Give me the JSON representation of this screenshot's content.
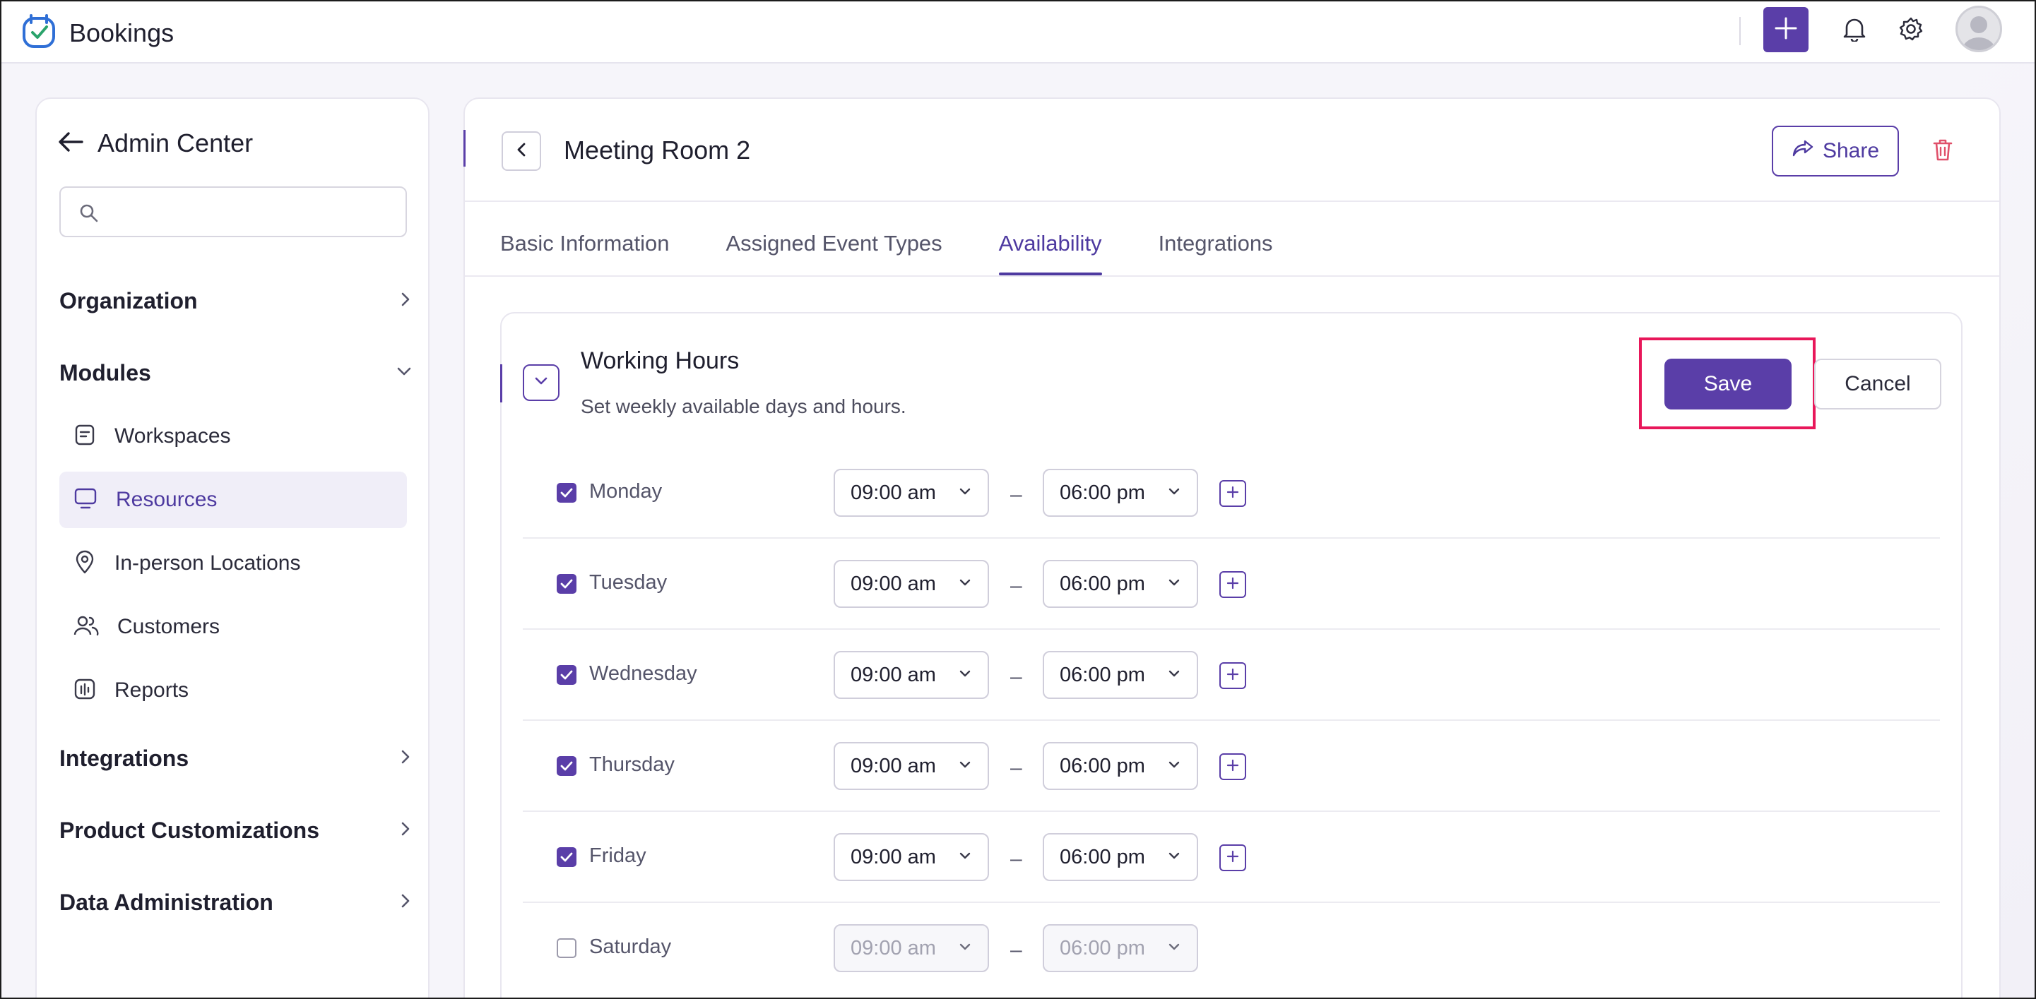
{
  "app": {
    "title": "Bookings",
    "brand_color": "#5a3ea8"
  },
  "topbar": {
    "icons": [
      "plus-icon",
      "bell-icon",
      "gear-icon",
      "avatar"
    ]
  },
  "sidebar": {
    "title": "Admin Center",
    "search": {
      "placeholder": "",
      "value": ""
    },
    "sections": {
      "organization": "Organization",
      "modules": "Modules",
      "integrations": "Integrations",
      "product_customizations": "Product Customizations",
      "data_administration": "Data Administration"
    },
    "module_items": [
      {
        "label": "Workspaces",
        "icon": "workspace-icon"
      },
      {
        "label": "Resources",
        "icon": "monitor-icon",
        "active": true
      },
      {
        "label": "In-person Locations",
        "icon": "location-pin-icon"
      },
      {
        "label": "Customers",
        "icon": "users-icon"
      },
      {
        "label": "Reports",
        "icon": "reports-icon"
      }
    ]
  },
  "main": {
    "title": "Meeting Room 2",
    "share_label": "Share",
    "tabs": [
      {
        "label": "Basic Information"
      },
      {
        "label": "Assigned Event Types"
      },
      {
        "label": "Availability",
        "active": true
      },
      {
        "label": "Integrations"
      }
    ],
    "working_hours": {
      "title": "Working Hours",
      "subtitle": "Set weekly available days and hours.",
      "save_label": "Save",
      "cancel_label": "Cancel",
      "days": [
        {
          "day": "Monday",
          "checked": true,
          "start": "09:00 am",
          "end": "06:00 pm"
        },
        {
          "day": "Tuesday",
          "checked": true,
          "start": "09:00 am",
          "end": "06:00 pm"
        },
        {
          "day": "Wednesday",
          "checked": true,
          "start": "09:00 am",
          "end": "06:00 pm"
        },
        {
          "day": "Thursday",
          "checked": true,
          "start": "09:00 am",
          "end": "06:00 pm"
        },
        {
          "day": "Friday",
          "checked": true,
          "start": "09:00 am",
          "end": "06:00 pm"
        },
        {
          "day": "Saturday",
          "checked": false,
          "start": "09:00 am",
          "end": "06:00 pm"
        }
      ],
      "separator": "–"
    }
  },
  "colors": {
    "accent": "#5a3ea8",
    "highlight": "#e8175a",
    "danger": "#e0506a"
  }
}
